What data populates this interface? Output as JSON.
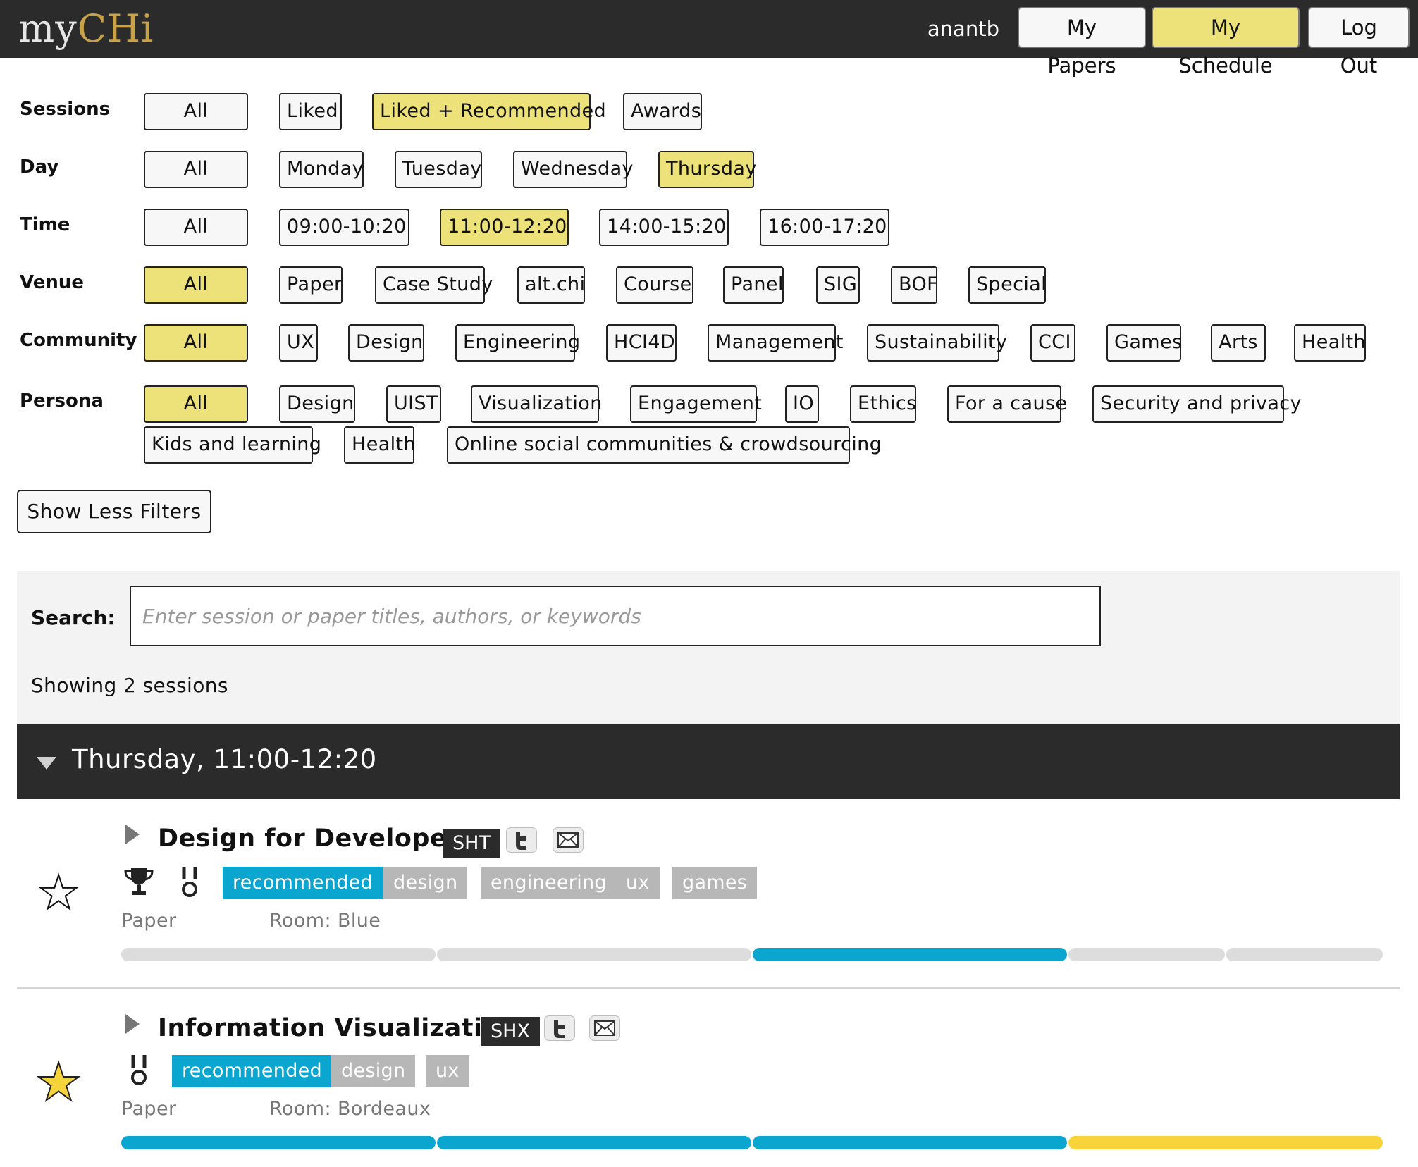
{
  "app": {
    "logo_my": "my",
    "logo_chi": "CHi",
    "username": "anantb",
    "nav": {
      "my_papers": "My Papers",
      "my_schedule": "My Schedule",
      "log_out": "Log Out"
    }
  },
  "colors": {
    "topbar": "#2b2b2b",
    "active_filter": "#ede27a",
    "recommended_tag": "#0ba6d0",
    "plain_tag": "#b7b7b7",
    "bar_blue": "#0ba6d0",
    "bar_yellow": "#f8d43a",
    "bar_grey": "#dcdcdc",
    "star_filled": "#f5d33b"
  },
  "filters": {
    "sessions": {
      "label": "Sessions",
      "options": [
        "All",
        "Liked",
        "Liked + Recommended",
        "Awards"
      ],
      "selected": "Liked + Recommended"
    },
    "day": {
      "label": "Day",
      "options": [
        "All",
        "Monday",
        "Tuesday",
        "Wednesday",
        "Thursday"
      ],
      "selected": "Thursday"
    },
    "time": {
      "label": "Time",
      "options": [
        "All",
        "09:00-10:20",
        "11:00-12:20",
        "14:00-15:20",
        "16:00-17:20"
      ],
      "selected": "11:00-12:20"
    },
    "venue": {
      "label": "Venue",
      "options": [
        "All",
        "Paper",
        "Case Study",
        "alt.chi",
        "Course",
        "Panel",
        "SIG",
        "BOF",
        "Special"
      ],
      "selected": "All"
    },
    "community": {
      "label": "Community",
      "options": [
        "All",
        "UX",
        "Design",
        "Engineering",
        "HCI4D",
        "Management",
        "Sustainability",
        "CCI",
        "Games",
        "Arts",
        "Health"
      ],
      "selected": "All"
    },
    "persona": {
      "label": "Persona",
      "options": [
        "All",
        "Design",
        "UIST",
        "Visualization",
        "Engagement",
        "IO",
        "Ethics",
        "For a cause",
        "Security and privacy",
        "Kids and learning",
        "Health",
        "Online social communities & crowdsourcing"
      ],
      "selected": "All"
    },
    "show_less": "Show Less Filters"
  },
  "search": {
    "label": "Search:",
    "placeholder": "Enter session or paper titles, authors, or keywords",
    "value": "",
    "showing": "Showing 2 sessions"
  },
  "group": {
    "title": "Thursday, 11:00-12:20"
  },
  "sessions": [
    {
      "title": "Design for Developers",
      "code": "SHT",
      "liked": false,
      "icons": [
        "trophy-icon",
        "medal-icon"
      ],
      "tags": [
        "recommended",
        "design",
        "engineering",
        "ux",
        "games"
      ],
      "type": "Paper",
      "room": "Room: Blue",
      "schedule_bar": [
        "grey",
        "grey",
        "blue",
        "grey",
        "grey"
      ]
    },
    {
      "title": "Information Visualization",
      "code": "SHX",
      "liked": true,
      "icons": [
        "medal-icon"
      ],
      "tags": [
        "recommended",
        "design",
        "ux"
      ],
      "type": "Paper",
      "room": "Room: Bordeaux",
      "schedule_bar": [
        "blue",
        "blue",
        "blue",
        "yellow"
      ]
    }
  ]
}
